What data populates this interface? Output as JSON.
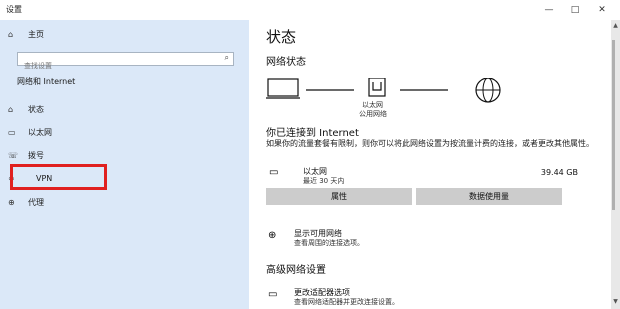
{
  "window": {
    "title": "设置",
    "minimize": "—",
    "maximize": "□",
    "close": "✕"
  },
  "sidebar": {
    "home": "主页",
    "search_placeholder": "查找设置",
    "section": "网络和 Internet",
    "items": [
      {
        "label": "状态",
        "icon": "home-icon"
      },
      {
        "label": "以太网",
        "icon": "ethernet-icon"
      },
      {
        "label": "拨号",
        "icon": "dialup-icon"
      },
      {
        "label": "VPN",
        "icon": "vpn-icon"
      },
      {
        "label": "代理",
        "icon": "globe-icon"
      }
    ]
  },
  "main": {
    "title": "状态",
    "network_status": "网络状态",
    "adapter_label1": "以太网",
    "adapter_label2": "公用网络",
    "connected_heading": "你已连接到 Internet",
    "connected_desc": "如果你的流量套餐有限制，则你可以将此网络设置为按流量计费的连接，或者更改其他属性。",
    "connection": {
      "name": "以太网",
      "period": "最近 30 天内",
      "usage": "39.44 GB"
    },
    "properties_button": "属性",
    "data_usage_button": "数据使用量",
    "show_networks": {
      "title": "显示可用网络",
      "desc": "查看周围的连接选项。"
    },
    "advanced_heading": "高级网络设置",
    "change_adapter": {
      "title": "更改适配器选项",
      "desc": "查看网络适配器并更改连接设置。"
    }
  },
  "colors": {
    "sidebar_bg": "#dbe8f8",
    "highlight": "#e02020",
    "button_bg": "#cccccc"
  }
}
